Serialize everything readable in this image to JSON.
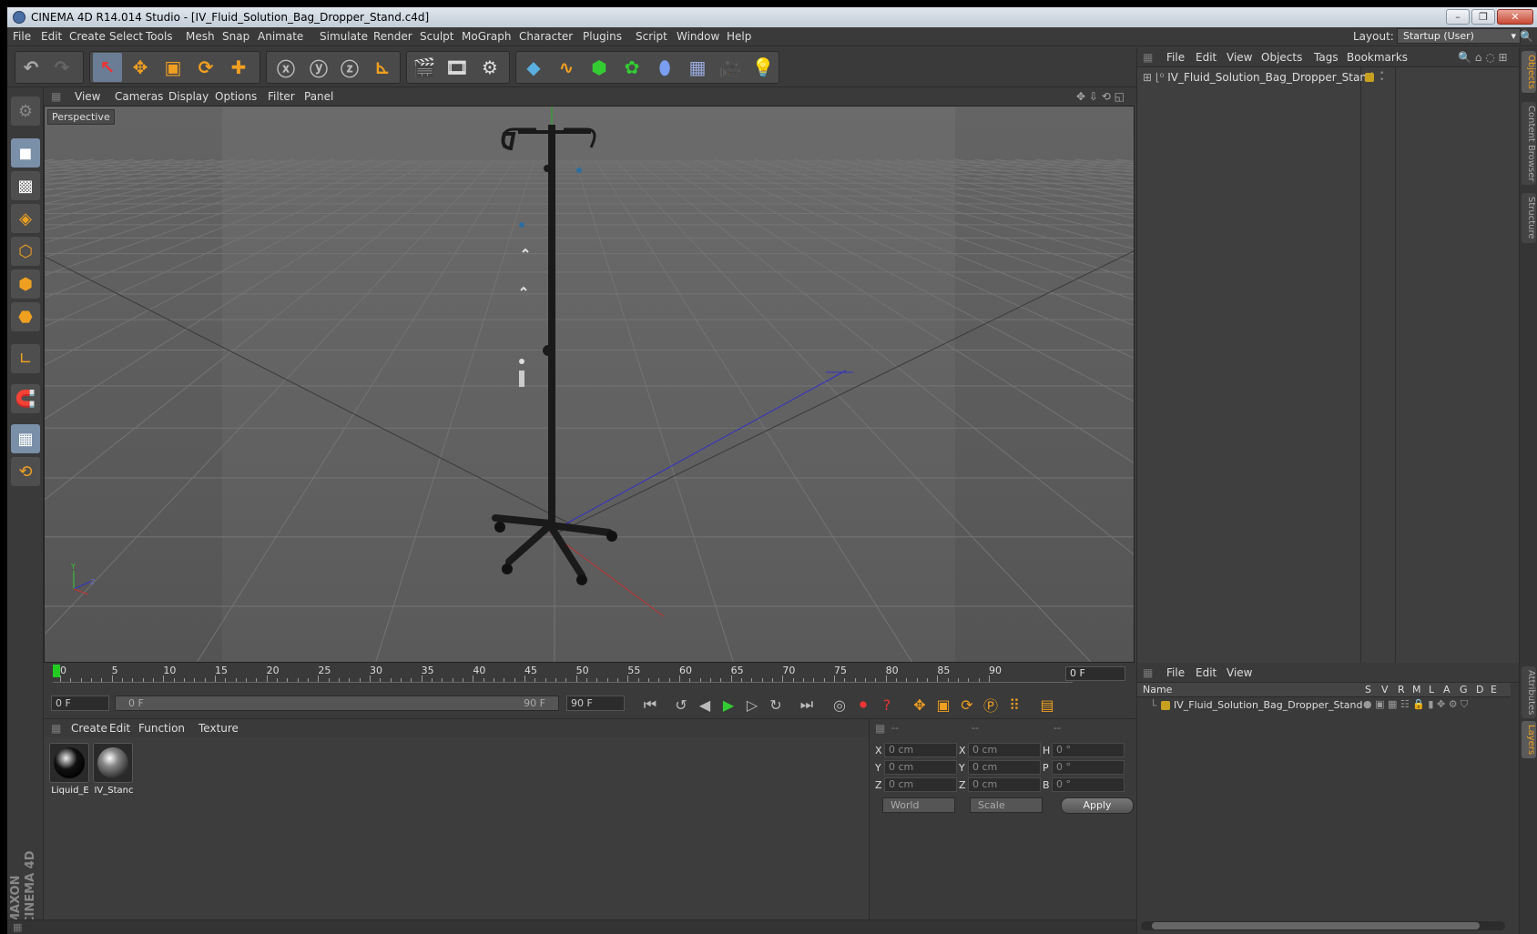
{
  "window": {
    "title": "CINEMA 4D R14.014 Studio - [IV_Fluid_Solution_Bag_Dropper_Stand.c4d]"
  },
  "menu": [
    "File",
    "Edit",
    "Create",
    "Select",
    "Tools",
    "Mesh",
    "Snap",
    "Animate",
    "Simulate",
    "Render",
    "Sculpt",
    "MoGraph",
    "Character",
    "Plugins",
    "Script",
    "Window",
    "Help"
  ],
  "layout": {
    "label": "Layout:",
    "value": "Startup (User)"
  },
  "viewport_menu": [
    "View",
    "Cameras",
    "Display",
    "Options",
    "Filter",
    "Panel"
  ],
  "viewport": {
    "label": "Perspective"
  },
  "timeline": {
    "ticks": [
      "0",
      "5",
      "10",
      "15",
      "20",
      "25",
      "30",
      "35",
      "40",
      "45",
      "50",
      "55",
      "60",
      "65",
      "70",
      "75",
      "80",
      "85",
      "90"
    ],
    "frame": "0 F",
    "start": "0 F",
    "range_start": "0 F",
    "range_end": "90 F",
    "end": "90 F"
  },
  "material_menu": [
    "Create",
    "Edit",
    "Function",
    "Texture"
  ],
  "materials": [
    {
      "name": "Liquid_E"
    },
    {
      "name": "IV_Stanc"
    }
  ],
  "coords": {
    "headers": [
      "--",
      "--",
      "--"
    ],
    "rows": [
      {
        "a": "X",
        "v1": "0 cm",
        "b": "X",
        "v2": "0 cm",
        "c": "H",
        "v3": "0 °"
      },
      {
        "a": "Y",
        "v1": "0 cm",
        "b": "Y",
        "v2": "0 cm",
        "c": "P",
        "v3": "0 °"
      },
      {
        "a": "Z",
        "v1": "0 cm",
        "b": "Z",
        "v2": "0 cm",
        "c": "B",
        "v3": "0 °"
      }
    ],
    "space": "World",
    "mode": "Scale",
    "apply": "Apply"
  },
  "objects_menu": [
    "File",
    "Edit",
    "View",
    "Objects",
    "Tags",
    "Bookmarks"
  ],
  "objects": [
    {
      "name": "IV_Fluid_Solution_Bag_Dropper_Stand"
    }
  ],
  "layers_menu": [
    "File",
    "Edit",
    "View"
  ],
  "layers_columns": [
    "Name",
    "S",
    "V",
    "R",
    "M",
    "L",
    "A",
    "G",
    "D",
    "E"
  ],
  "layers": [
    {
      "name": "IV_Fluid_Solution_Bag_Dropper_Stand"
    }
  ],
  "side_tabs": [
    "Objects",
    "Content Browser",
    "Structure",
    "Attributes",
    "Layers"
  ],
  "brand": "MAXON CINEMA 4D",
  "colors": {
    "accent": "#f0a020",
    "panel": "#3a3a3a",
    "axis_x": "#c02020",
    "axis_y": "#20a020",
    "axis_z": "#2020c0"
  }
}
